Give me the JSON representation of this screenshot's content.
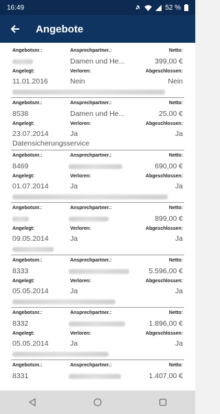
{
  "status": {
    "time": "16:49",
    "battery": "52 %"
  },
  "appbar": {
    "title": "Angebote"
  },
  "labels": {
    "angebotsnr": "Angebotsnr.:",
    "ansprechpartner": "Ansprechpartner.:",
    "netto": "Netto:",
    "angelegt": "Angelegt:",
    "verloren": "Verloren:",
    "abgeschlossen": "Abgeschlossen:"
  },
  "offers": [
    {
      "nr": "",
      "partner": "Damen und He...",
      "netto": "399,00 €",
      "angelegt": "11.01.2016",
      "verloren": "Nein",
      "abgeschlossen": "Nein",
      "extra": ""
    },
    {
      "nr": "8538",
      "partner": "Damen und He...",
      "netto": "25,00 €",
      "angelegt": "23.07.2014",
      "verloren": "Ja",
      "abgeschlossen": "Ja",
      "extra": "Datensicherungsservice"
    },
    {
      "nr": "8469",
      "partner": "",
      "netto": "690,00 €",
      "angelegt": "01.07.2014",
      "verloren": "Ja",
      "abgeschlossen": "Ja",
      "extra": ""
    },
    {
      "nr": "",
      "partner": "",
      "netto": "899,00 €",
      "angelegt": "09.05.2014",
      "verloren": "Ja",
      "abgeschlossen": "Ja",
      "extra": ""
    },
    {
      "nr": "8333",
      "partner": "",
      "netto": "5.596,00 €",
      "angelegt": "05.05.2014",
      "verloren": "Ja",
      "abgeschlossen": "Ja",
      "extra": ""
    },
    {
      "nr": "8332",
      "partner": "",
      "netto": "1.896,00 €",
      "angelegt": "05.05.2014",
      "verloren": "Ja",
      "abgeschlossen": "Ja",
      "extra": ""
    },
    {
      "nr": "8331",
      "partner": "",
      "netto": "1.407,00 €",
      "angelegt": "",
      "verloren": "",
      "abgeschlossen": "",
      "extra": ""
    }
  ],
  "colors": {
    "statusbar": "#0d2a52",
    "appbar": "#0f3461"
  }
}
